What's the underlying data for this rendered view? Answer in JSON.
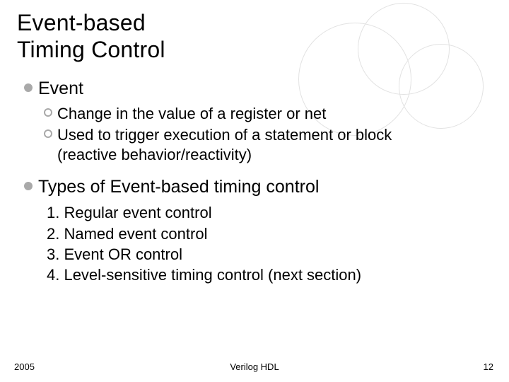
{
  "title_line1": "Event-based",
  "title_line2": "Timing Control",
  "section1": {
    "heading": "Event",
    "items": [
      "Change in the value of a register or net",
      "Used to trigger execution of a statement or block (reactive behavior/reactivity)"
    ]
  },
  "section2": {
    "heading": "Types of Event-based timing control",
    "items": [
      "1. Regular event control",
      "2. Named event control",
      "3. Event OR control",
      "4. Level-sensitive timing control (next section)"
    ]
  },
  "footer": {
    "left": "2005",
    "center": "Verilog HDL",
    "right": "12"
  }
}
